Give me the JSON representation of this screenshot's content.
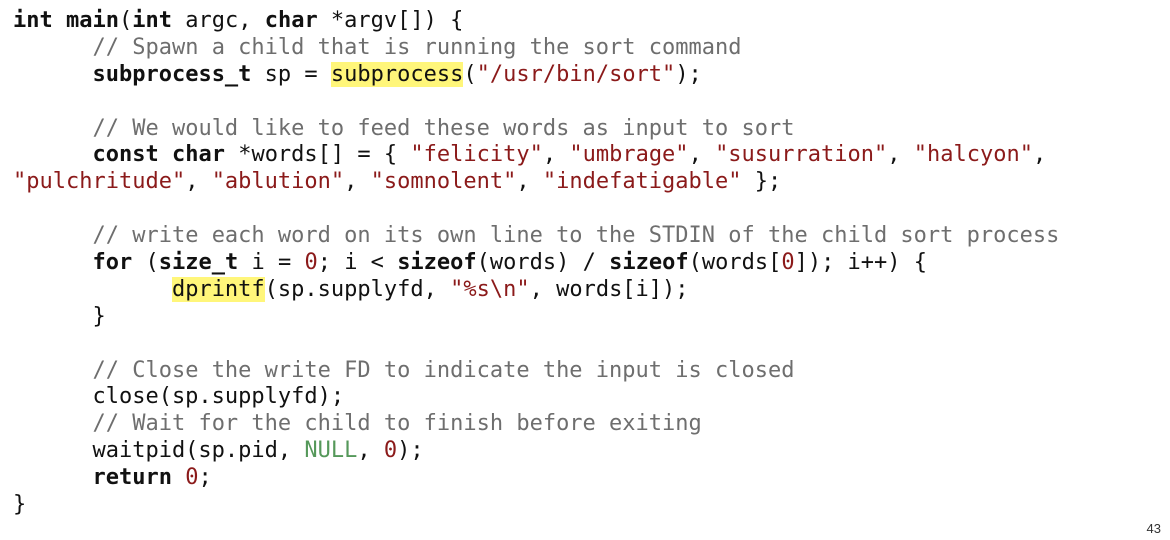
{
  "code_lines": [
    [
      {
        "t": "int",
        "c": "kw"
      },
      {
        "t": " "
      },
      {
        "t": "main",
        "c": "kw"
      },
      {
        "t": "("
      },
      {
        "t": "int",
        "c": "kw"
      },
      {
        "t": " argc, "
      },
      {
        "t": "char",
        "c": "kw"
      },
      {
        "t": " *argv[]) {"
      }
    ],
    [
      {
        "t": "      "
      },
      {
        "t": "// Spawn a child that is running the sort command",
        "c": "cmt"
      }
    ],
    [
      {
        "t": "      "
      },
      {
        "t": "subprocess_t",
        "c": "kw"
      },
      {
        "t": " sp = "
      },
      {
        "t": "subprocess",
        "c": "hl"
      },
      {
        "t": "("
      },
      {
        "t": "\"/usr/bin/sort\"",
        "c": "str"
      },
      {
        "t": ");"
      }
    ],
    [],
    [
      {
        "t": "      "
      },
      {
        "t": "// We would like to feed these words as input to sort",
        "c": "cmt"
      }
    ],
    [
      {
        "t": "      "
      },
      {
        "t": "const",
        "c": "kw"
      },
      {
        "t": " "
      },
      {
        "t": "char",
        "c": "kw"
      },
      {
        "t": " *words[] = { "
      },
      {
        "t": "\"felicity\"",
        "c": "str"
      },
      {
        "t": ", "
      },
      {
        "t": "\"umbrage\"",
        "c": "str"
      },
      {
        "t": ", "
      },
      {
        "t": "\"susurration\"",
        "c": "str"
      },
      {
        "t": ", "
      },
      {
        "t": "\"halcyon\"",
        "c": "str"
      },
      {
        "t": ","
      }
    ],
    [
      {
        "t": "\"pulchritude\"",
        "c": "str"
      },
      {
        "t": ", "
      },
      {
        "t": "\"ablution\"",
        "c": "str"
      },
      {
        "t": ", "
      },
      {
        "t": "\"somnolent\"",
        "c": "str"
      },
      {
        "t": ", "
      },
      {
        "t": "\"indefatigable\"",
        "c": "str"
      },
      {
        "t": " };"
      }
    ],
    [],
    [
      {
        "t": "      "
      },
      {
        "t": "// write each word on its own line to the STDIN of the child sort process",
        "c": "cmt"
      }
    ],
    [
      {
        "t": "      "
      },
      {
        "t": "for",
        "c": "kw"
      },
      {
        "t": " ("
      },
      {
        "t": "size_t",
        "c": "kw"
      },
      {
        "t": " i = "
      },
      {
        "t": "0",
        "c": "num"
      },
      {
        "t": "; i < "
      },
      {
        "t": "sizeof",
        "c": "kw"
      },
      {
        "t": "(words) / "
      },
      {
        "t": "sizeof",
        "c": "kw"
      },
      {
        "t": "(words["
      },
      {
        "t": "0",
        "c": "num"
      },
      {
        "t": "]); i++) {"
      }
    ],
    [
      {
        "t": "            "
      },
      {
        "t": "dprintf",
        "c": "hl"
      },
      {
        "t": "(sp.supplyfd, "
      },
      {
        "t": "\"%s\\n\"",
        "c": "str"
      },
      {
        "t": ", words[i]);"
      }
    ],
    [
      {
        "t": "      }"
      }
    ],
    [],
    [
      {
        "t": "      "
      },
      {
        "t": "// Close the write FD to indicate the input is closed",
        "c": "cmt"
      }
    ],
    [
      {
        "t": "      close(sp.supplyfd);"
      }
    ],
    [
      {
        "t": "      "
      },
      {
        "t": "// Wait for the child to finish before exiting",
        "c": "cmt"
      }
    ],
    [
      {
        "t": "      waitpid(sp.pid, "
      },
      {
        "t": "NULL",
        "c": "nul"
      },
      {
        "t": ", "
      },
      {
        "t": "0",
        "c": "num"
      },
      {
        "t": ");"
      }
    ],
    [
      {
        "t": "      "
      },
      {
        "t": "return",
        "c": "kw"
      },
      {
        "t": " "
      },
      {
        "t": "0",
        "c": "num"
      },
      {
        "t": ";"
      }
    ],
    [
      {
        "t": "}"
      }
    ]
  ],
  "page_number": "43",
  "colors": {
    "keyword": "#111111",
    "string": "#8b1a1a",
    "comment": "#6e6e6e",
    "null_literal": "#55985a",
    "highlight": "#fff67a"
  }
}
